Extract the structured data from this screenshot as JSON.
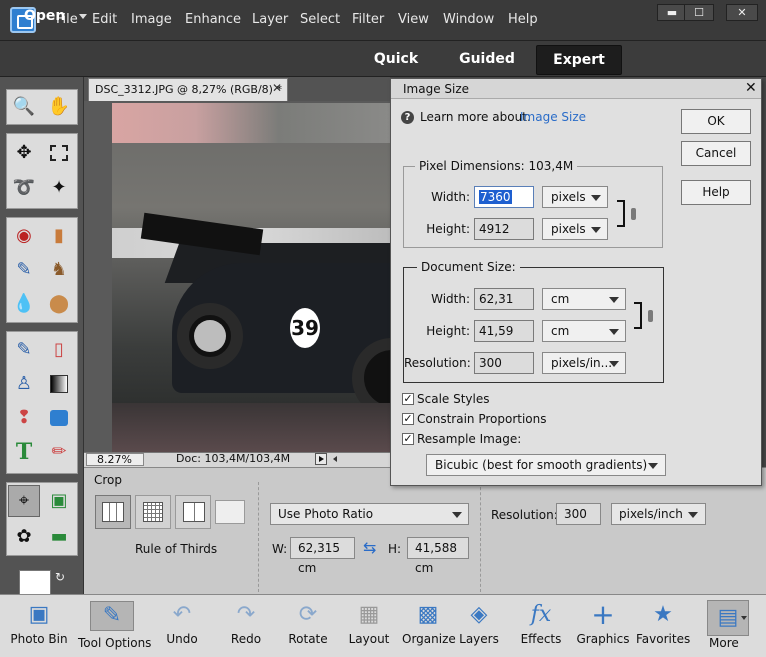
{
  "menubar": {
    "items": [
      "File",
      "Edit",
      "Image",
      "Enhance",
      "Layer",
      "Select",
      "Filter",
      "View",
      "Window",
      "Help"
    ],
    "window_buttons": [
      "▬",
      "☐",
      "✕"
    ]
  },
  "modebar": {
    "open_label": "Open",
    "modes": [
      "Quick",
      "Guided",
      "Expert"
    ],
    "active_mode": "Expert"
  },
  "document": {
    "tab_title": "DSC_3312.JPG @ 8,27% (RGB/8) *",
    "zoom": "8.27%",
    "doc_info": "Doc: 103,4M/103,4M",
    "car_number": "39"
  },
  "tool_options": {
    "section_label": "Crop",
    "preset_label": "Rule of Thirds",
    "ratio_value": "Use Photo Ratio",
    "width_label": "W:",
    "width_value": "62,315 cm",
    "height_label": "H:",
    "height_value": "41,588 cm",
    "resolution_label": "Resolution:",
    "resolution_value": "300",
    "resolution_unit": "pixels/inch"
  },
  "panelbar": {
    "items": [
      "Photo Bin",
      "Tool Options",
      "Undo",
      "Redo",
      "Rotate",
      "Layout",
      "Organize",
      "Layers",
      "Effects",
      "Graphics",
      "Favorites",
      "More"
    ]
  },
  "dialog": {
    "title": "Image Size",
    "learn_text": "Learn more about:",
    "learn_link": "Image Size",
    "ok": "OK",
    "cancel": "Cancel",
    "help": "Help",
    "pixel_dimensions": {
      "label": "Pixel Dimensions:",
      "size": "103,4M",
      "width_label": "Width:",
      "width": "7360",
      "width_unit": "pixels",
      "height_label": "Height:",
      "height": "4912",
      "height_unit": "pixels"
    },
    "document_size": {
      "label": "Document Size:",
      "width_label": "Width:",
      "width": "62,31",
      "width_unit": "cm",
      "height_label": "Height:",
      "height": "41,59",
      "height_unit": "cm",
      "resolution_label": "Resolution:",
      "resolution": "300",
      "resolution_unit": "pixels/in..."
    },
    "checkboxes": [
      {
        "label": "Scale Styles",
        "checked": true
      },
      {
        "label": "Constrain Proportions",
        "checked": true
      },
      {
        "label": "Resample Image:",
        "checked": true
      }
    ],
    "resample_method": "Bicubic (best for smooth gradients)"
  },
  "colors": {
    "accent_link": "#2a6cc8",
    "selection": "#1e5fd0",
    "icon_blue": "#3a78c2"
  }
}
